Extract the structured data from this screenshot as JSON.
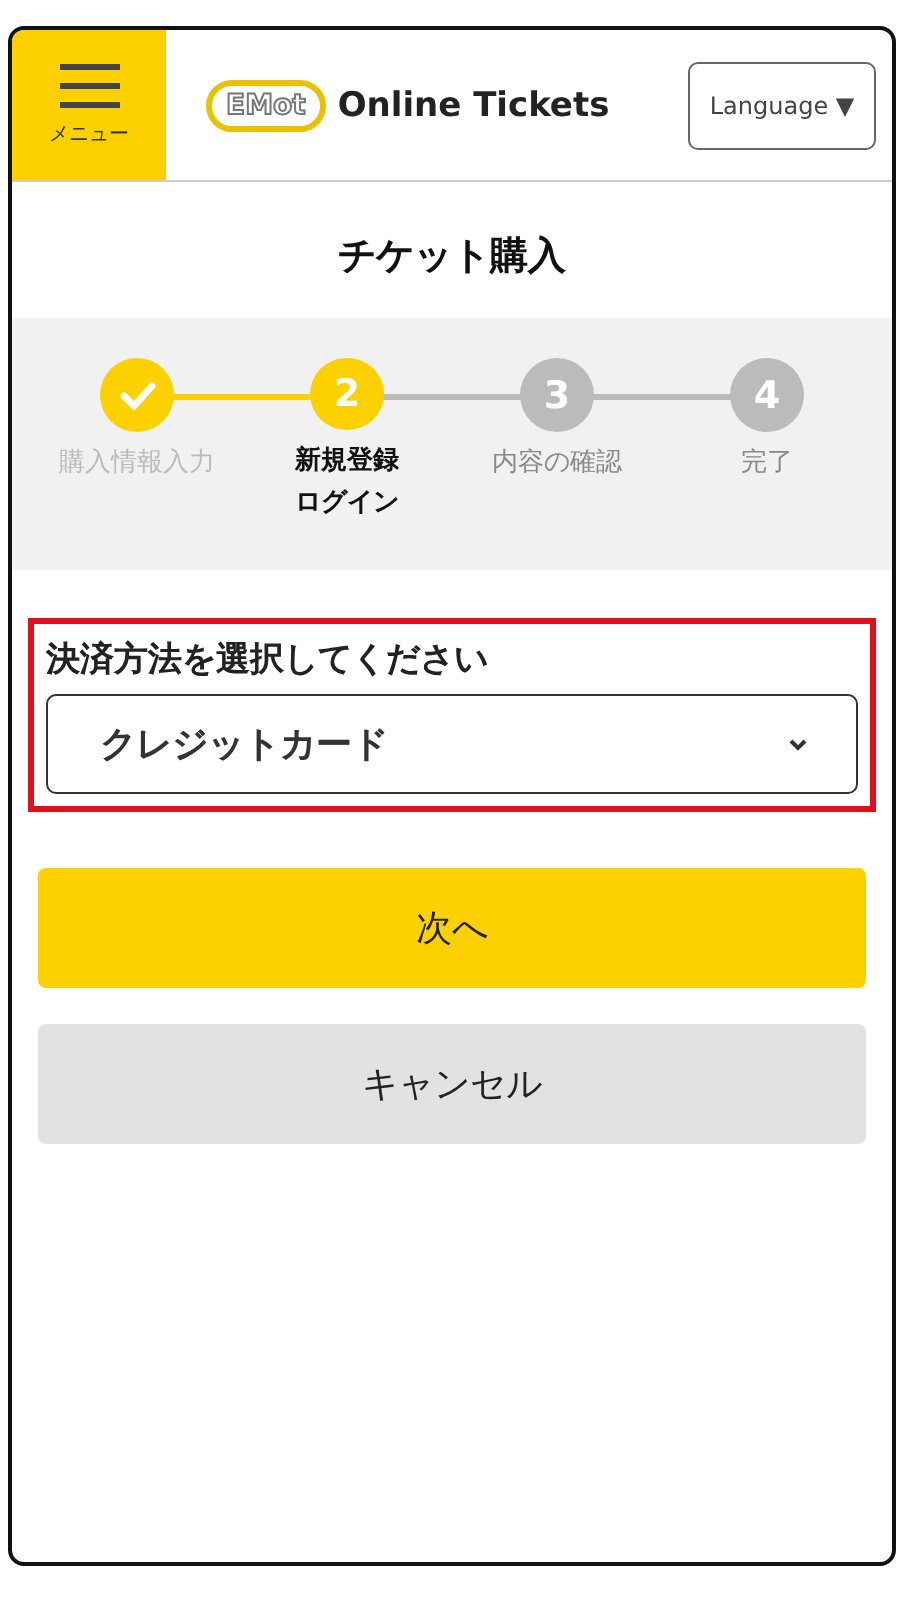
{
  "header": {
    "menu_label": "メニュー",
    "logo_mark": "EMot",
    "site_title": "Online Tickets",
    "language_button": "Language ▼"
  },
  "page_title": "チケット購入",
  "steps": [
    {
      "label_lines": [
        "購入情報入力"
      ],
      "kind": "done"
    },
    {
      "number": "2",
      "label_lines": [
        "新規登録",
        "ログイン"
      ],
      "kind": "current"
    },
    {
      "number": "3",
      "label_lines": [
        "内容の確認"
      ],
      "kind": "upcoming"
    },
    {
      "number": "4",
      "label_lines": [
        "完了"
      ],
      "kind": "upcoming"
    }
  ],
  "payment": {
    "label": "決済方法を選択してください",
    "value": "クレジットカード",
    "highlighted": true
  },
  "buttons": [
    {
      "label": "次へ",
      "kind": "primary"
    },
    {
      "label": "キャンセル",
      "kind": "secondary"
    }
  ]
}
